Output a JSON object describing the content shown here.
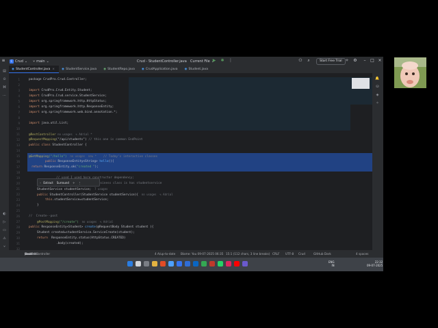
{
  "titlebar": {
    "project_badge": "C",
    "project": "Crud",
    "branch": "main",
    "window_title": "Crud - StudentController.java",
    "run_config": "Current File",
    "trial_button": "Start Free Trial"
  },
  "tabs": [
    {
      "label": "StudentController.java",
      "active": true
    },
    {
      "label": "StudentService.java"
    },
    {
      "label": "StudentRepo.java"
    },
    {
      "label": "CrudApplication.java"
    },
    {
      "label": "Student.java"
    }
  ],
  "gutter_numbers": [
    "1",
    "2",
    "3",
    "4",
    "5",
    "6",
    "7",
    "8",
    "9",
    "10",
    "11",
    "12",
    "13",
    "14",
    "15",
    "16",
    "17",
    "18",
    "19",
    "20",
    "21",
    "22",
    "23",
    "24",
    "25",
    "26",
    "27",
    "28",
    "29",
    "30",
    "31",
    "32",
    "33",
    "34"
  ],
  "code": {
    "l1": "package CrudPro.Crud.Controller;",
    "l3_kw": "import",
    "l3": " CrudPro.Crud.Entity.Student;",
    "l4_kw": "import",
    "l4": " CrudPro.Crud.service.StudentService;",
    "l5_kw": "import",
    "l5": " org.springframework.http.HttpStatus;",
    "l6_kw": "import",
    "l6": " org.springframework.http.ResponseEntity;",
    "l7_kw": "import",
    "l7": " org.springframework.web.bind.annotation.*;",
    "l9_kw": "import",
    "l9": " java.util.List;",
    "l11_ann": "@RestController",
    "l11_hint": " no usages  ✎ Adrial *",
    "l12_ann": "@RequestMapping",
    "l12": "(\"/api/students\") ",
    "l12_cmt": "// this one is common EndPoint",
    "l13_kw": "public class",
    "l13": " StudentController {",
    "l15_ann": "@GetMapping",
    "l15": "(\"/hello\")",
    "l15_hint": "  no usages  new *",
    "l15_cmt": "// Today's interactive classes",
    "l16_kw": "public",
    "l16": " ResponseEntity<String> ",
    "l16_fn": "hello",
    "l16_b": "(){",
    "l17_kw": "return",
    "l17": " ResponseEntity.ok(",
    "l17_str": "\"created \"",
    "l17_b": ");",
    "l19_cmt": "// used I used here constructor dependency;",
    "l20_cmt": "// we are simply create class to business class is has studentservice",
    "l21": "StudentService studentService;",
    "l21_hint": "  7 usages",
    "l22_kw": "public",
    "l22": " StudentController(StudentService studentService){",
    "l22_hint": "  no usages  ✎ Adrial",
    "l23_kw": "this",
    "l23": ".studentService=studentService;",
    "l24": "}",
    "l26_cmt": "//  Create--post",
    "l27_ann": "@PostMapping",
    "l27": "(\"/create\")",
    "l27_hint": "  no usages  ✎ Adrial",
    "l28_kw": "public",
    "l28": " ResponseEntity<Student> ",
    "l28_fn": "create",
    "l28_b": "(@RequestBody Student student ){",
    "l29": "Student created=studentService.ServiceCreate(student);",
    "l30_kw": "return",
    "l30": "  ResponseEntity.status(HttpStatus.CREATED)",
    "l31": ".body(created);"
  },
  "popup": {
    "extract": "Extract",
    "surround": "Surround"
  },
  "statusbar": {
    "path": [
      "Crud",
      "src",
      "main",
      "java",
      "CrudPro",
      "Crud",
      "Controller",
      "StudentController"
    ],
    "sep": ">",
    "vcs": "4 A/up-to-date",
    "blame": "Blame: You 09-07-2025 06:35",
    "position": "15:1 (112 chars, 3 line breaks)",
    "line_ending": "CRLF",
    "encoding": "UTF-8",
    "project": "Crud",
    "theme": "GitHub Dark",
    "indent": "4 spaces"
  },
  "taskbar": {
    "lang": "ENG\nIN",
    "time": "22:32",
    "date": "09-07-2025"
  },
  "colors": {
    "accent": "#3574f0",
    "selection": "#214283",
    "editor_bg": "#1e1f22"
  }
}
